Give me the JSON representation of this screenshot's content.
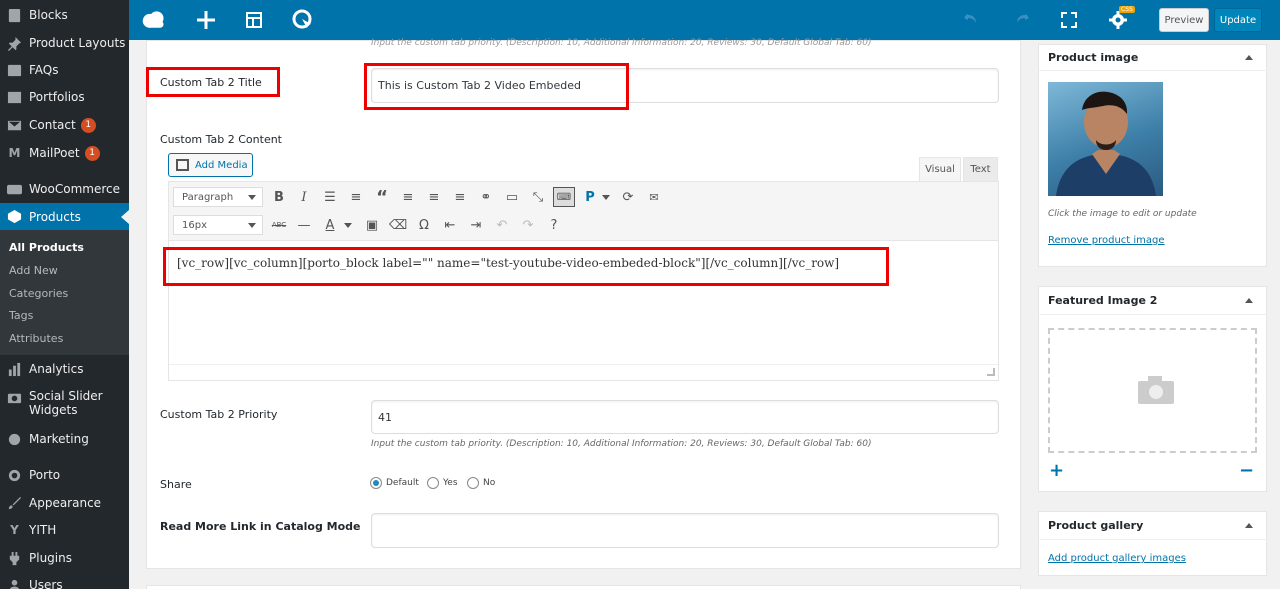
{
  "sidebar": {
    "items": [
      {
        "label": "Blocks",
        "icon": "blocks-icon"
      },
      {
        "label": "Product Layouts",
        "icon": "pin-icon"
      },
      {
        "label": "FAQs",
        "icon": "faq-icon"
      },
      {
        "label": "Portfolios",
        "icon": "portfolio-icon"
      },
      {
        "label": "Contact",
        "icon": "mail-icon",
        "badge": "1"
      },
      {
        "label": "MailPoet",
        "icon": "mailpoet-icon",
        "badge": "1"
      },
      {
        "label": "WooCommerce",
        "icon": "woocommerce-icon"
      },
      {
        "label": "Products",
        "icon": "products-icon"
      },
      {
        "label": "Analytics",
        "icon": "analytics-icon"
      },
      {
        "label": "Social Slider Widgets",
        "icon": "camera-icon"
      },
      {
        "label": "Marketing",
        "icon": "megaphone-icon"
      },
      {
        "label": "Porto",
        "icon": "porto-icon"
      },
      {
        "label": "Appearance",
        "icon": "brush-icon"
      },
      {
        "label": "YITH",
        "icon": "yith-icon"
      },
      {
        "label": "Plugins",
        "icon": "plugin-icon"
      },
      {
        "label": "Users",
        "icon": "users-icon"
      }
    ],
    "submenu": [
      "All Products",
      "Add New",
      "Categories",
      "Tags",
      "Attributes"
    ]
  },
  "topbar": {
    "preview_label": "Preview",
    "update_label": "Update",
    "css_badge": "CSS"
  },
  "form": {
    "top_hint": "Input the custom tab priority. (Description: 10, Additional Information: 20, Reviews: 30, Default Global Tab: 60)",
    "tab2_title_label": "Custom Tab 2 Title",
    "tab2_title_value": "This is Custom Tab 2 Video Embeded",
    "tab2_content_label": "Custom Tab 2 Content",
    "add_media_label": "Add Media",
    "visual_tab": "Visual",
    "text_tab": "Text",
    "paragraph_select": "Paragraph",
    "fontsize_select": "16px",
    "editor_content": "[vc_row][vc_column][porto_block label=\"\" name=\"test-youtube-video-embeded-block\"][/vc_column][/vc_row]",
    "tab2_priority_label": "Custom Tab 2 Priority",
    "tab2_priority_value": "41",
    "priority_hint": "Input the custom tab priority. (Description: 10, Additional Information: 20, Reviews: 30, Default Global Tab: 60)",
    "share_label": "Share",
    "share_options": [
      "Default",
      "Yes",
      "No"
    ],
    "share_selected": "Default",
    "readmore_label": "Read More Link in Catalog Mode",
    "readmore_value": ""
  },
  "side": {
    "product_image_title": "Product image",
    "product_image_hint": "Click the image to edit or update",
    "remove_image_link": "Remove product image",
    "featured2_title": "Featured Image 2",
    "gallery_title": "Product gallery",
    "gallery_link": "Add product gallery images"
  }
}
